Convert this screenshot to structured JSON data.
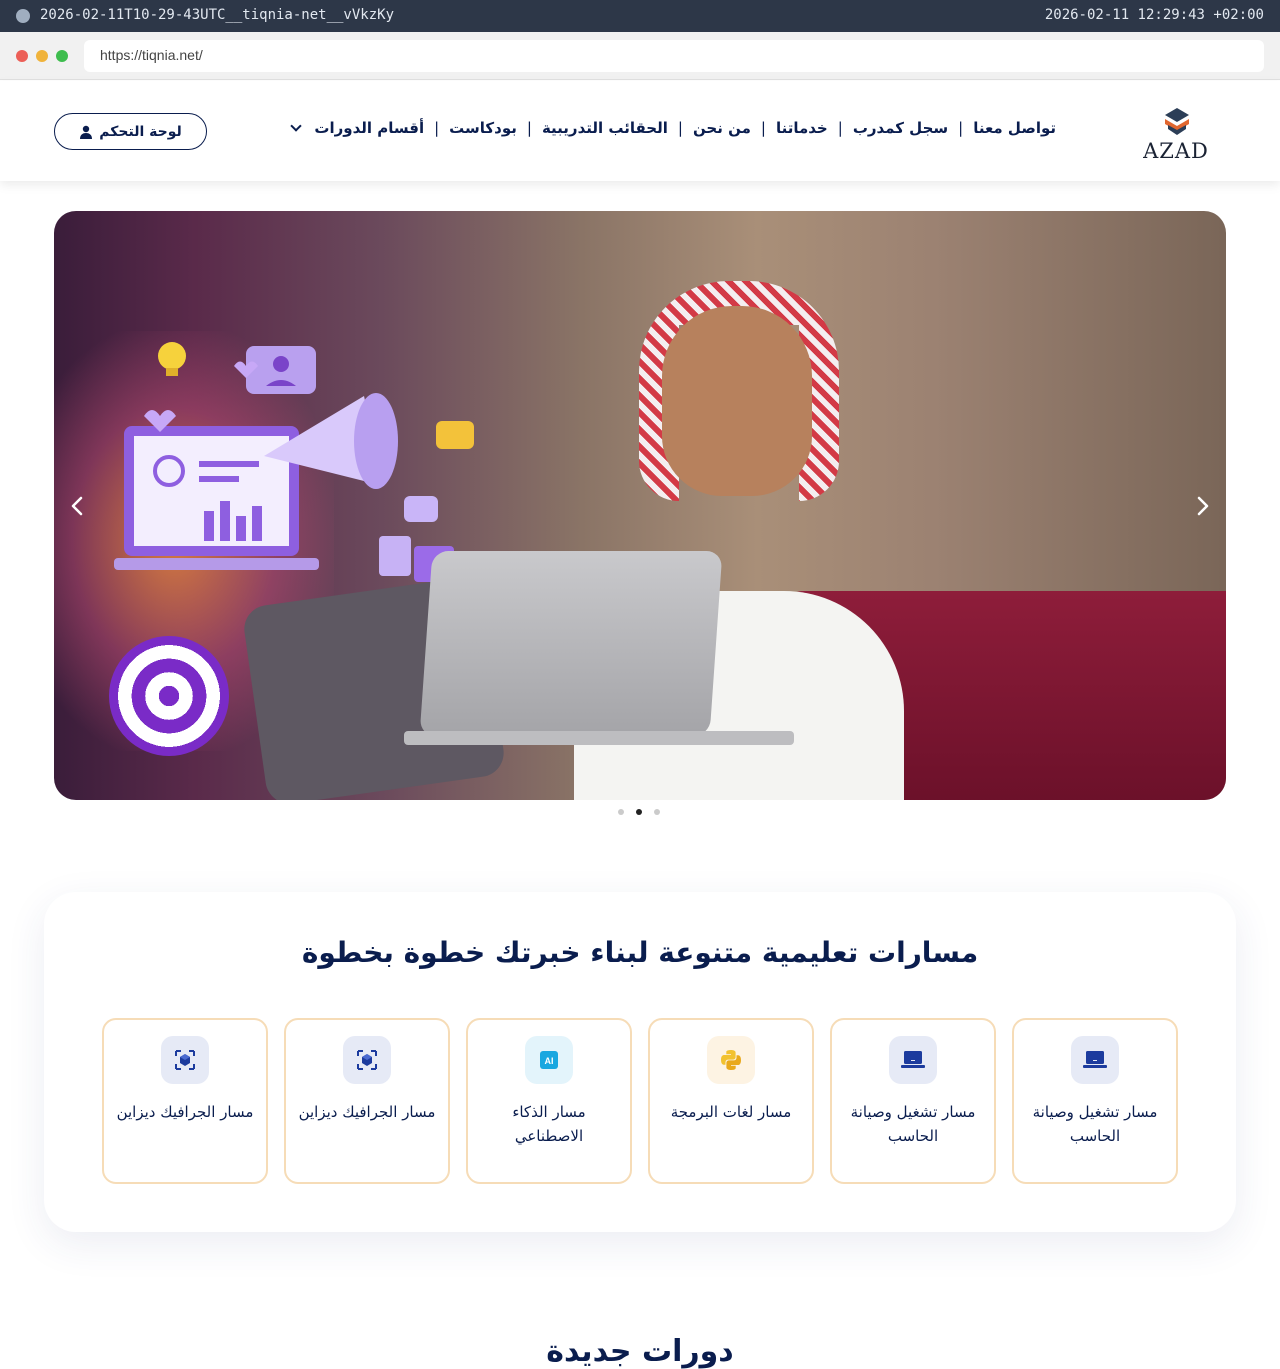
{
  "capture": {
    "title": "2026-02-11T10-29-43UTC__tiqnia-net__vVkzKy",
    "timestamp": "2026-02-11 12:29:43 +02:00"
  },
  "browser": {
    "url": "https://tiqnia.net/"
  },
  "header": {
    "logo_text": "AZAD",
    "nav": [
      {
        "label": "أقسام الدورات",
        "has_dropdown": true
      },
      {
        "label": "بودكاست"
      },
      {
        "label": "الحقائب التدريبية"
      },
      {
        "label": "من نحن"
      },
      {
        "label": "خدماتنا"
      },
      {
        "label": "سجل كمدرب"
      },
      {
        "label": "تواصل معنا"
      }
    ],
    "dashboard_label": "لوحة التحكم"
  },
  "hero": {
    "slide_count": 3,
    "active_slide": 2
  },
  "paths": {
    "title": "مسارات تعليمية متنوعة لبناء خبرتك خطوة بخطوة",
    "items": [
      {
        "name": "مسار تشغيل وصيانة الحاسب",
        "icon": "laptop-icon",
        "icon_bg": "#e6eaf6",
        "icon_color": "#1c3b9e"
      },
      {
        "name": "مسار تشغيل وصيانة الحاسب",
        "icon": "laptop-icon",
        "icon_bg": "#e6eaf6",
        "icon_color": "#1c3b9e"
      },
      {
        "name": "مسار لغات البرمجة",
        "icon": "python-icon",
        "icon_bg": "#fdf3e3",
        "icon_color": "#f2c230"
      },
      {
        "name": "مسار الذكاء الاصطناعي",
        "icon": "ai-icon",
        "icon_bg": "#e3f4fb",
        "icon_color": "#19a7e0"
      },
      {
        "name": "مسار الجرافيك ديزاين",
        "icon": "cube-icon",
        "icon_bg": "#e6eaf6",
        "icon_color": "#1c3b9e"
      },
      {
        "name": "مسار الجرافيك ديزاين",
        "icon": "cube-icon",
        "icon_bg": "#e6eaf6",
        "icon_color": "#1c3b9e"
      }
    ]
  },
  "next_section": {
    "title": "دورات جديدة"
  },
  "colors": {
    "brand_navy": "#0a1d4e",
    "card_border": "#f6dcb7"
  }
}
